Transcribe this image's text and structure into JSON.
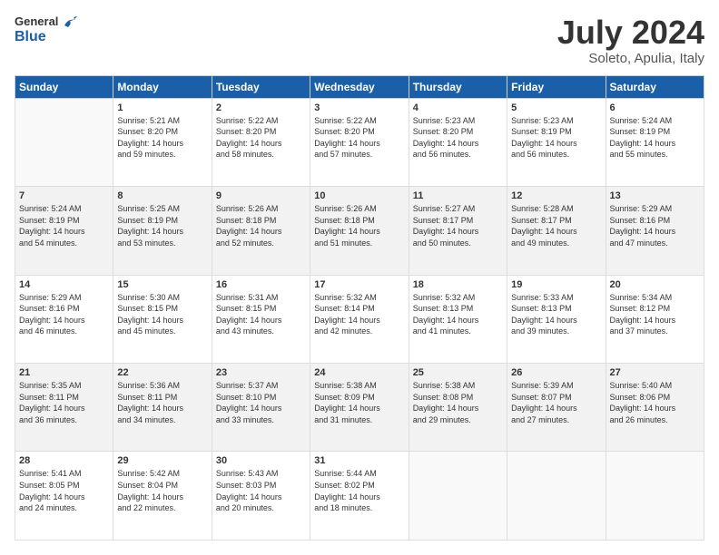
{
  "header": {
    "logo_general": "General",
    "logo_blue": "Blue",
    "title": "July 2024",
    "location": "Soleto, Apulia, Italy"
  },
  "weekdays": [
    "Sunday",
    "Monday",
    "Tuesday",
    "Wednesday",
    "Thursday",
    "Friday",
    "Saturday"
  ],
  "weeks": [
    [
      {
        "day": "",
        "info": ""
      },
      {
        "day": "1",
        "info": "Sunrise: 5:21 AM\nSunset: 8:20 PM\nDaylight: 14 hours\nand 59 minutes."
      },
      {
        "day": "2",
        "info": "Sunrise: 5:22 AM\nSunset: 8:20 PM\nDaylight: 14 hours\nand 58 minutes."
      },
      {
        "day": "3",
        "info": "Sunrise: 5:22 AM\nSunset: 8:20 PM\nDaylight: 14 hours\nand 57 minutes."
      },
      {
        "day": "4",
        "info": "Sunrise: 5:23 AM\nSunset: 8:20 PM\nDaylight: 14 hours\nand 56 minutes."
      },
      {
        "day": "5",
        "info": "Sunrise: 5:23 AM\nSunset: 8:19 PM\nDaylight: 14 hours\nand 56 minutes."
      },
      {
        "day": "6",
        "info": "Sunrise: 5:24 AM\nSunset: 8:19 PM\nDaylight: 14 hours\nand 55 minutes."
      }
    ],
    [
      {
        "day": "7",
        "info": "Sunrise: 5:24 AM\nSunset: 8:19 PM\nDaylight: 14 hours\nand 54 minutes."
      },
      {
        "day": "8",
        "info": "Sunrise: 5:25 AM\nSunset: 8:19 PM\nDaylight: 14 hours\nand 53 minutes."
      },
      {
        "day": "9",
        "info": "Sunrise: 5:26 AM\nSunset: 8:18 PM\nDaylight: 14 hours\nand 52 minutes."
      },
      {
        "day": "10",
        "info": "Sunrise: 5:26 AM\nSunset: 8:18 PM\nDaylight: 14 hours\nand 51 minutes."
      },
      {
        "day": "11",
        "info": "Sunrise: 5:27 AM\nSunset: 8:17 PM\nDaylight: 14 hours\nand 50 minutes."
      },
      {
        "day": "12",
        "info": "Sunrise: 5:28 AM\nSunset: 8:17 PM\nDaylight: 14 hours\nand 49 minutes."
      },
      {
        "day": "13",
        "info": "Sunrise: 5:29 AM\nSunset: 8:16 PM\nDaylight: 14 hours\nand 47 minutes."
      }
    ],
    [
      {
        "day": "14",
        "info": "Sunrise: 5:29 AM\nSunset: 8:16 PM\nDaylight: 14 hours\nand 46 minutes."
      },
      {
        "day": "15",
        "info": "Sunrise: 5:30 AM\nSunset: 8:15 PM\nDaylight: 14 hours\nand 45 minutes."
      },
      {
        "day": "16",
        "info": "Sunrise: 5:31 AM\nSunset: 8:15 PM\nDaylight: 14 hours\nand 43 minutes."
      },
      {
        "day": "17",
        "info": "Sunrise: 5:32 AM\nSunset: 8:14 PM\nDaylight: 14 hours\nand 42 minutes."
      },
      {
        "day": "18",
        "info": "Sunrise: 5:32 AM\nSunset: 8:13 PM\nDaylight: 14 hours\nand 41 minutes."
      },
      {
        "day": "19",
        "info": "Sunrise: 5:33 AM\nSunset: 8:13 PM\nDaylight: 14 hours\nand 39 minutes."
      },
      {
        "day": "20",
        "info": "Sunrise: 5:34 AM\nSunset: 8:12 PM\nDaylight: 14 hours\nand 37 minutes."
      }
    ],
    [
      {
        "day": "21",
        "info": "Sunrise: 5:35 AM\nSunset: 8:11 PM\nDaylight: 14 hours\nand 36 minutes."
      },
      {
        "day": "22",
        "info": "Sunrise: 5:36 AM\nSunset: 8:11 PM\nDaylight: 14 hours\nand 34 minutes."
      },
      {
        "day": "23",
        "info": "Sunrise: 5:37 AM\nSunset: 8:10 PM\nDaylight: 14 hours\nand 33 minutes."
      },
      {
        "day": "24",
        "info": "Sunrise: 5:38 AM\nSunset: 8:09 PM\nDaylight: 14 hours\nand 31 minutes."
      },
      {
        "day": "25",
        "info": "Sunrise: 5:38 AM\nSunset: 8:08 PM\nDaylight: 14 hours\nand 29 minutes."
      },
      {
        "day": "26",
        "info": "Sunrise: 5:39 AM\nSunset: 8:07 PM\nDaylight: 14 hours\nand 27 minutes."
      },
      {
        "day": "27",
        "info": "Sunrise: 5:40 AM\nSunset: 8:06 PM\nDaylight: 14 hours\nand 26 minutes."
      }
    ],
    [
      {
        "day": "28",
        "info": "Sunrise: 5:41 AM\nSunset: 8:05 PM\nDaylight: 14 hours\nand 24 minutes."
      },
      {
        "day": "29",
        "info": "Sunrise: 5:42 AM\nSunset: 8:04 PM\nDaylight: 14 hours\nand 22 minutes."
      },
      {
        "day": "30",
        "info": "Sunrise: 5:43 AM\nSunset: 8:03 PM\nDaylight: 14 hours\nand 20 minutes."
      },
      {
        "day": "31",
        "info": "Sunrise: 5:44 AM\nSunset: 8:02 PM\nDaylight: 14 hours\nand 18 minutes."
      },
      {
        "day": "",
        "info": ""
      },
      {
        "day": "",
        "info": ""
      },
      {
        "day": "",
        "info": ""
      }
    ]
  ]
}
